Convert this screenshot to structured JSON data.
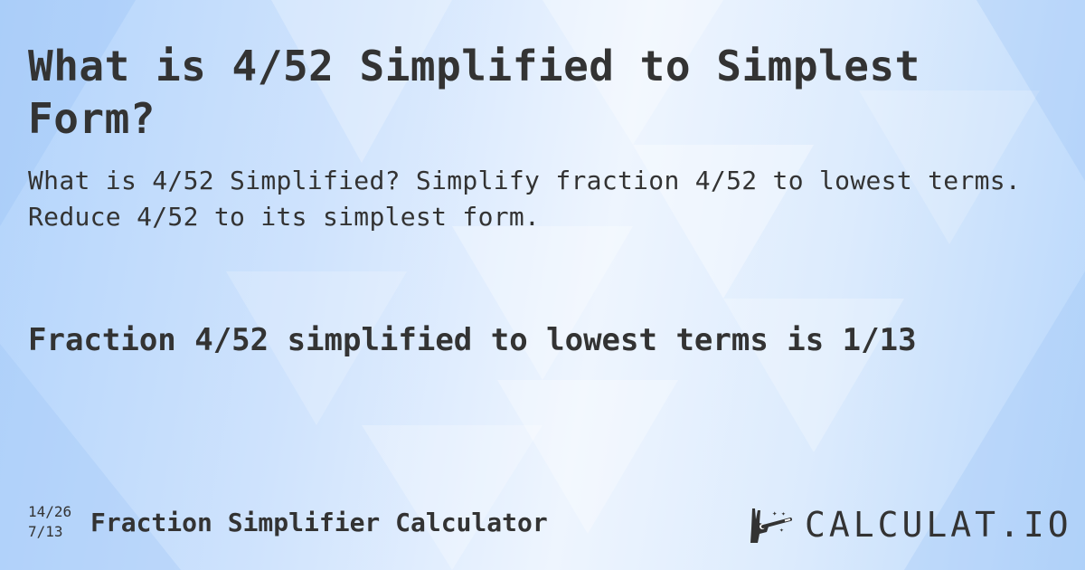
{
  "header": {
    "title": "What is 4/52 Simplified to Simplest Form?",
    "subtitle": "What is 4/52 Simplified? Simplify fraction 4/52 to lowest terms. Reduce 4/52 to its simplest form."
  },
  "result": {
    "text": "Fraction 4/52 simplified to lowest terms is 1/13"
  },
  "footer": {
    "fraction_top": "14/26",
    "fraction_bottom": "7/13",
    "calculator_name": "Fraction Simplifier Calculator",
    "logo_text": "CALCULAT.IO",
    "logo_icon": "magic-wand-hand-icon"
  }
}
